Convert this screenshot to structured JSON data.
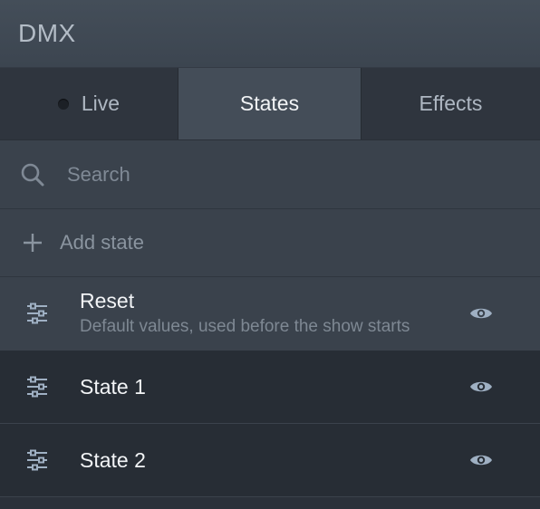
{
  "app": {
    "title": "DMX"
  },
  "tabs": [
    {
      "label": "Live",
      "status": "inactive"
    },
    {
      "label": "States",
      "active": true
    },
    {
      "label": "Effects"
    }
  ],
  "search": {
    "placeholder": "Search",
    "value": ""
  },
  "add_state": {
    "label": "Add state"
  },
  "states": [
    {
      "name": "Reset",
      "description": "Default values, used before the show starts",
      "selected": true,
      "icon": "sliders-icon",
      "action_icon": "eye-icon"
    },
    {
      "name": "State 1",
      "description": "",
      "selected": false,
      "icon": "sliders-icon",
      "action_icon": "eye-icon"
    },
    {
      "name": "State 2",
      "description": "",
      "selected": false,
      "icon": "sliders-icon",
      "action_icon": "eye-icon"
    }
  ],
  "colors": {
    "accent_icon": "#9fb0c3",
    "selected_tab_bg": "#444d58",
    "row_bg": "#272d35",
    "selected_row_bg": "#3a424c"
  }
}
